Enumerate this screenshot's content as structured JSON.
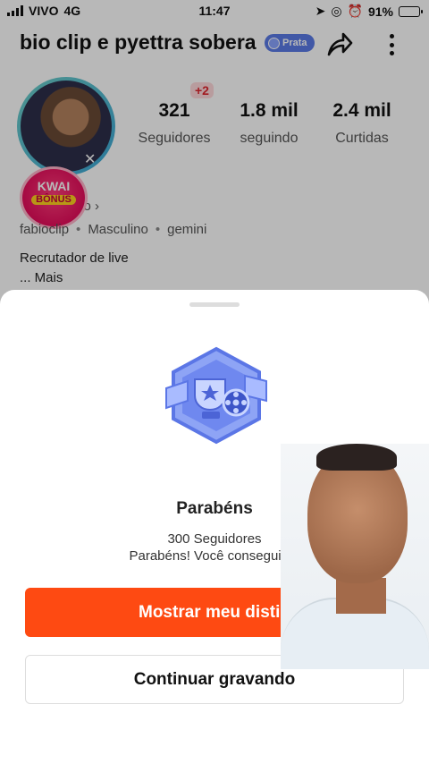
{
  "status_bar": {
    "carrier": "VIVO",
    "network": "4G",
    "time": "11:47",
    "battery": "91%",
    "battery_level": 0.91
  },
  "profile": {
    "name": "bio clip e pyettra sobera",
    "level_badge": "Prata",
    "stats": [
      {
        "value": "321",
        "label": "Seguidores"
      },
      {
        "value": "1.8 mil",
        "label": "seguindo"
      },
      {
        "value": "2.4 mil",
        "label": "Curtidas"
      }
    ],
    "followers_increase": "+2",
    "live_link": "vo ›",
    "kwai_bonus": {
      "line1": "KWAI",
      "line2": "BÔNUS"
    },
    "meta": [
      "fabioclip",
      "Masculino",
      "gemini"
    ],
    "bio": "Recrutador de live",
    "more": "... Mais"
  },
  "sheet": {
    "title": "Parabéns",
    "subtitle": "300 Seguidores",
    "message": "Parabéns! Você conseguiu u",
    "primary_button": "Mostrar meu distin",
    "secondary_button": "Continuar gravando"
  },
  "colors": {
    "accent": "#fe4a12",
    "badge": "#5a7be6",
    "plus_badge": "#e0262f"
  }
}
